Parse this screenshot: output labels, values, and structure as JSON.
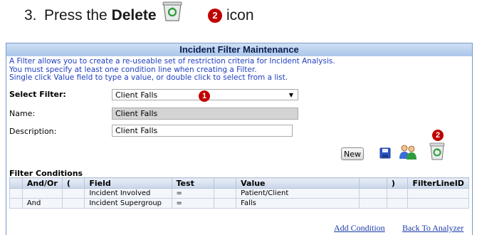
{
  "instruction": {
    "number": "3.",
    "prefix": "Press the",
    "bold_word": "Delete",
    "badge": "2",
    "suffix": "icon"
  },
  "panel": {
    "title": "Incident Filter Maintenance",
    "info_lines": [
      "A Filter allows you to create a re-useable set of restriction criteria for Incident Analysis.",
      "You must specify at least one condition line when creating a Filter.",
      "Single click Value field to type a value, or double click to select from a list."
    ],
    "select_filter_label": "Select Filter:",
    "select_filter_value": "Client Falls",
    "badge_1": "1",
    "name_label": "Name:",
    "name_value": "Client Falls",
    "description_label": "Description:",
    "description_value": "Client Falls",
    "badge_2": "2",
    "new_button": "New",
    "conditions_title": "Filter Conditions",
    "columns": [
      "",
      "And/Or",
      "(",
      "Field",
      "Test",
      "",
      "Value",
      "",
      ")",
      "FilterLineID"
    ],
    "rows": [
      [
        "",
        "",
        "",
        "Incident Involved",
        "=",
        "",
        "Patient/Client",
        "",
        "",
        ""
      ],
      [
        "",
        "And",
        "",
        "Incident Supergroup",
        "=",
        "",
        "Falls",
        "",
        "",
        ""
      ]
    ],
    "add_condition_link": "Add Condition",
    "back_link": "Back To Analyzer"
  },
  "colors": {
    "accent_red": "#c00000",
    "link_blue": "#1c3aa9",
    "info_blue": "#1f3fbf",
    "title_bar": "#aac6e9"
  },
  "icons": {
    "save": "floppy-disk-icon",
    "users": "users-icon",
    "delete": "recycle-bin-icon"
  }
}
